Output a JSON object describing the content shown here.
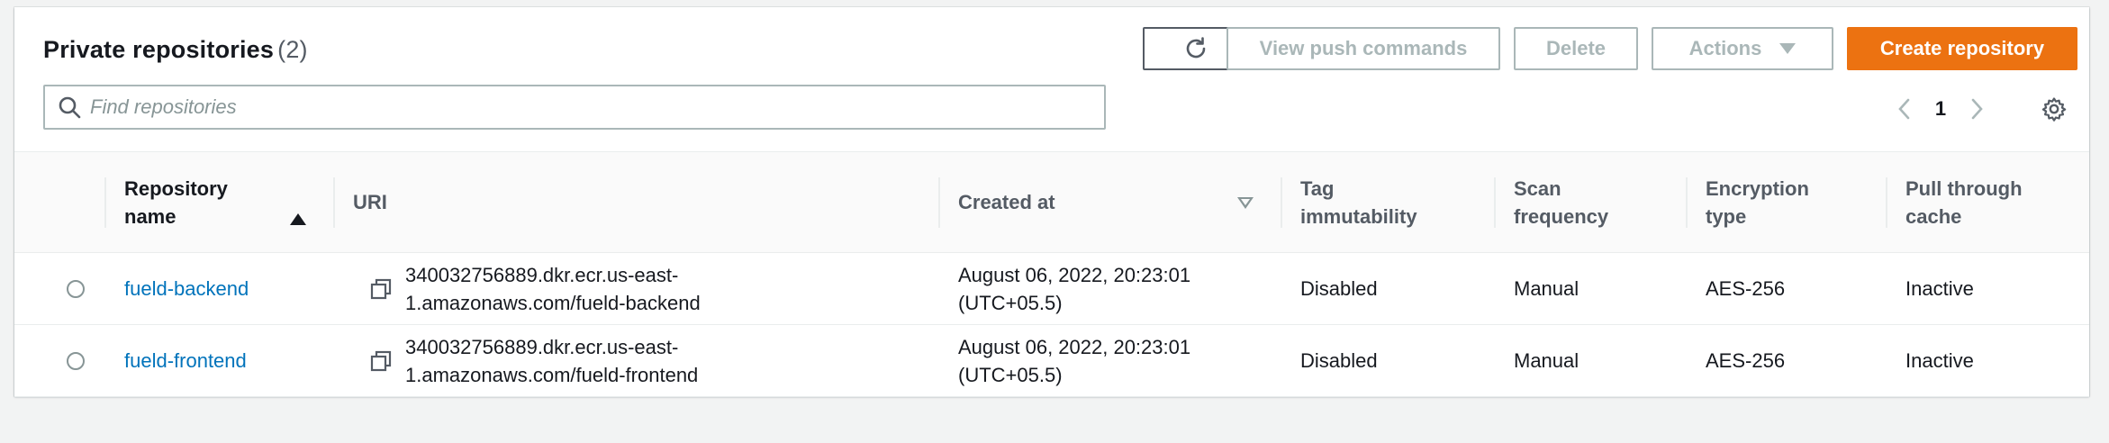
{
  "header": {
    "title": "Private repositories",
    "count": "(2)"
  },
  "toolbar": {
    "refresh_icon": "refresh-icon",
    "view_push_label": "View push commands",
    "delete_label": "Delete",
    "actions_label": "Actions",
    "create_label": "Create repository",
    "colors": {
      "primary": "#ec7211",
      "disabled": "#aab7b8",
      "link": "#0073bb"
    }
  },
  "search": {
    "placeholder": "Find repositories",
    "value": ""
  },
  "pagination": {
    "current_page": "1"
  },
  "table": {
    "columns": [
      "Repository name",
      "URI",
      "Created at",
      "Tag immutability",
      "Scan frequency",
      "Encryption type",
      "Pull through cache"
    ],
    "rows": [
      {
        "name": "fueld-backend",
        "uri": "340032756889.dkr.ecr.us-east-1.amazonaws.com/fueld-backend",
        "created": "August 06, 2022, 20:23:01 (UTC+05.5)",
        "tag_immutability": "Disabled",
        "scan_frequency": "Manual",
        "encryption": "AES-256",
        "pull_through_cache": "Inactive"
      },
      {
        "name": "fueld-frontend",
        "uri": "340032756889.dkr.ecr.us-east-1.amazonaws.com/fueld-frontend",
        "created": "August 06, 2022, 20:23:01 (UTC+05.5)",
        "tag_immutability": "Disabled",
        "scan_frequency": "Manual",
        "encryption": "AES-256",
        "pull_through_cache": "Inactive"
      }
    ]
  }
}
